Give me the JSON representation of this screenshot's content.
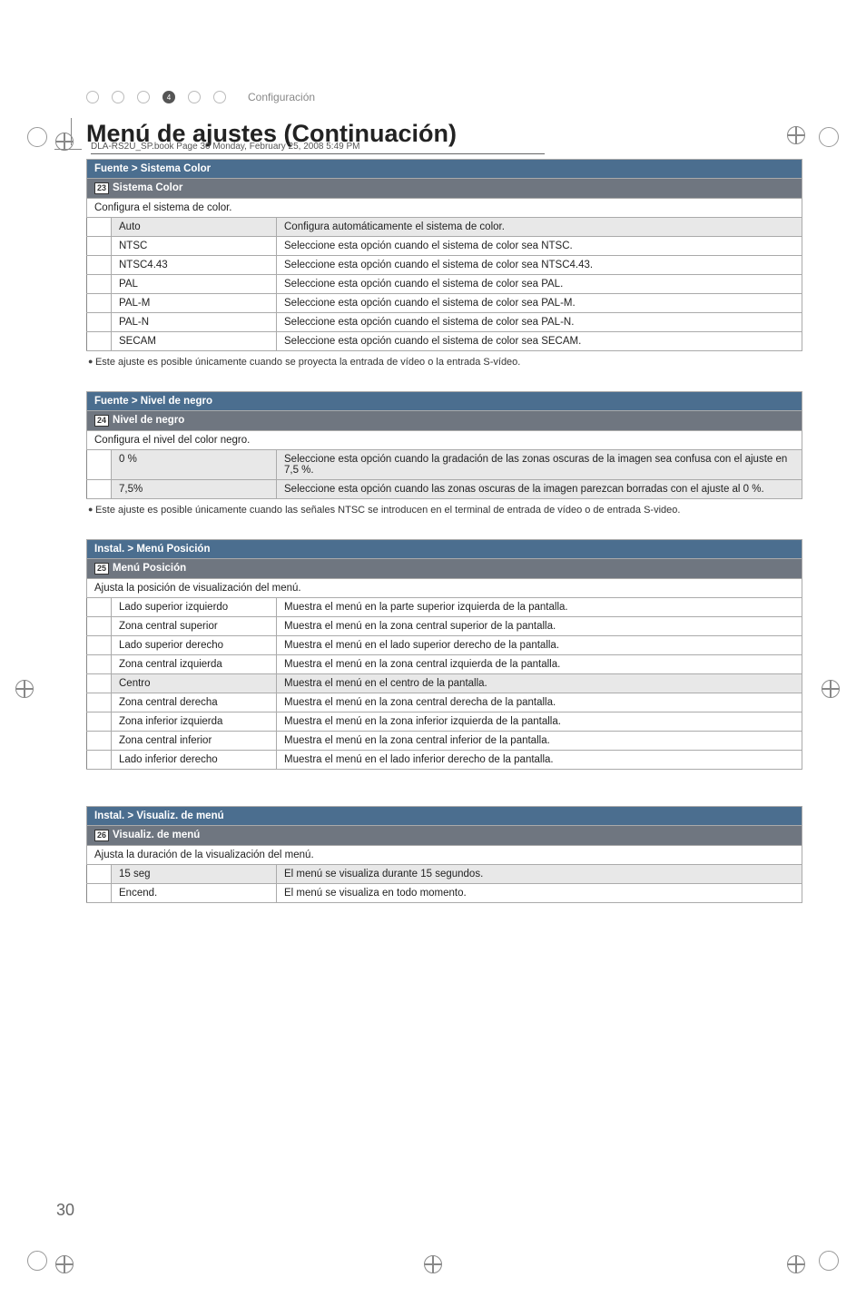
{
  "header_line": "DLA-RS2U_SP.book  Page 30  Monday, February 25, 2008  5:49 PM",
  "nav": {
    "step_number": "4",
    "label": "Configuración"
  },
  "title": "Menú de ajustes (Continuación)",
  "section1": {
    "header": "Fuente > Sistema Color",
    "sub_number": "23",
    "sub_label": "Sistema Color",
    "desc": "Configura el sistema de color.",
    "rows": [
      {
        "k": "Auto",
        "v": "Configura automáticamente el sistema de color.",
        "sel": true
      },
      {
        "k": "NTSC",
        "v": "Seleccione esta opción cuando el sistema de color sea NTSC."
      },
      {
        "k": "NTSC4.43",
        "v": "Seleccione esta opción cuando el sistema de color sea NTSC4.43."
      },
      {
        "k": "PAL",
        "v": "Seleccione esta opción cuando el sistema de color sea PAL."
      },
      {
        "k": "PAL-M",
        "v": "Seleccione esta opción cuando el sistema de color sea PAL-M."
      },
      {
        "k": "PAL-N",
        "v": "Seleccione esta opción cuando el sistema de color sea PAL-N."
      },
      {
        "k": "SECAM",
        "v": "Seleccione esta opción cuando el sistema de color sea SECAM."
      }
    ],
    "note": "Este ajuste es posible únicamente cuando se proyecta la entrada de vídeo o la entrada S-vídeo."
  },
  "section2": {
    "header": "Fuente > Nivel de negro",
    "sub_number": "24",
    "sub_label": "Nivel de negro",
    "desc": "Configura el nivel del color negro.",
    "rows": [
      {
        "k": "0 %",
        "v": "Seleccione esta opción cuando la gradación de las zonas oscuras de la imagen sea confusa con el ajuste en 7,5 %.",
        "sel": true
      },
      {
        "k": "7,5%",
        "v": "Seleccione esta opción cuando las zonas oscuras de la imagen parezcan borradas con el ajuste al 0 %.",
        "sel": true
      }
    ],
    "note": "Este ajuste es posible únicamente cuando las señales NTSC se introducen en el terminal de entrada de vídeo o de entrada S-video."
  },
  "section3": {
    "header": "Instal. > Menú Posición",
    "sub_number": "25",
    "sub_label": "Menú Posición",
    "desc": "Ajusta la posición de visualización del menú.",
    "rows": [
      {
        "k": "Lado superior izquierdo",
        "v": "Muestra el menú en la parte superior izquierda de la pantalla."
      },
      {
        "k": "Zona central superior",
        "v": "Muestra el menú en la zona central superior de la pantalla."
      },
      {
        "k": "Lado superior derecho",
        "v": "Muestra el menú en el lado superior derecho de la pantalla."
      },
      {
        "k": "Zona central izquierda",
        "v": "Muestra el menú en la zona central izquierda de la pantalla."
      },
      {
        "k": "Centro",
        "v": "Muestra el menú en el centro de la pantalla.",
        "sel": true
      },
      {
        "k": "Zona central derecha",
        "v": "Muestra el menú en la zona central derecha de la pantalla."
      },
      {
        "k": "Zona inferior izquierda",
        "v": "Muestra el menú en la zona inferior izquierda de la pantalla."
      },
      {
        "k": "Zona central inferior",
        "v": "Muestra el menú en la zona central inferior de la pantalla."
      },
      {
        "k": "Lado inferior derecho",
        "v": "Muestra el menú en el lado inferior derecho de la pantalla."
      }
    ]
  },
  "section4": {
    "header": "Instal. > Visualiz. de menú",
    "sub_number": "26",
    "sub_label": "Visualiz. de menú",
    "desc": "Ajusta la duración de la visualización del menú.",
    "rows": [
      {
        "k": "15 seg",
        "v": "El menú se visualiza durante 15 segundos.",
        "sel": true
      },
      {
        "k": "Encend.",
        "v": "El menú se visualiza en todo momento."
      }
    ]
  },
  "page_number": "30"
}
